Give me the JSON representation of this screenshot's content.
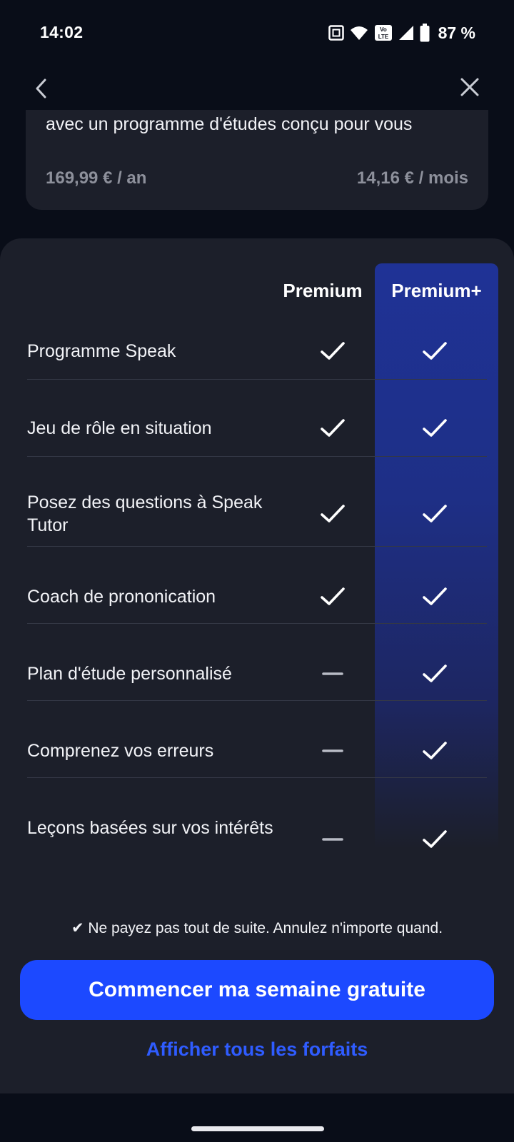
{
  "status_bar": {
    "time": "14:02",
    "battery": "87 %",
    "icons": [
      "nfc-icon",
      "wifi-icon",
      "volte-icon",
      "signal-icon",
      "battery-icon"
    ]
  },
  "nav": {
    "back_icon": "chevron-left-icon",
    "close_icon": "close-icon"
  },
  "plan_card": {
    "description": "avec un programme d'études conçu pour vous",
    "price_year": "169,99 € / an",
    "price_month": "14,16 € / mois"
  },
  "comparison": {
    "columns": [
      "Premium",
      "Premium+"
    ],
    "rows": [
      {
        "label": "Programme Speak",
        "premium": true,
        "premium_plus": true
      },
      {
        "label": "Jeu de rôle en situation",
        "premium": true,
        "premium_plus": true
      },
      {
        "label": "Posez des questions à Speak Tutor",
        "premium": true,
        "premium_plus": true
      },
      {
        "label": "Coach de prononication",
        "premium": true,
        "premium_plus": true
      },
      {
        "label": "Plan d'étude personnalisé",
        "premium": false,
        "premium_plus": true
      },
      {
        "label": "Comprenez vos erreurs",
        "premium": false,
        "premium_plus": true
      },
      {
        "label": "Leçons basées sur vos intérêts",
        "premium": false,
        "premium_plus": true
      }
    ]
  },
  "footer": {
    "note": "✔ Ne payez pas tout de suite. Annulez n'importe quand.",
    "cta_label": "Commencer ma semaine gratuite",
    "link_label": "Afficher tous les forfaits"
  },
  "colors": {
    "background": "#090d18",
    "panel": "#1c1f2a",
    "accent": "#1c49ff",
    "link": "#2f5cff",
    "premium_plus_column": "#1f3296"
  }
}
